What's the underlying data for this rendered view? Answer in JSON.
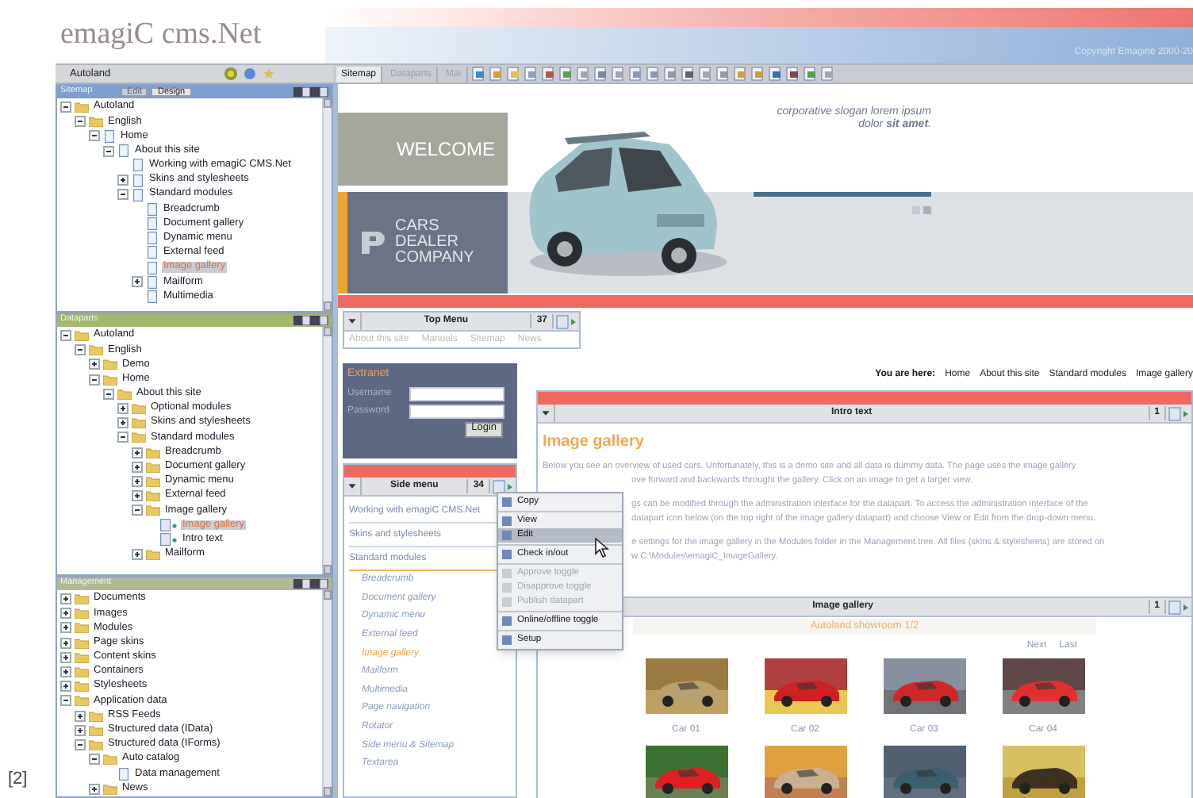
{
  "caption": "[2]",
  "logo": {
    "text": "emagiC cms.Net"
  },
  "header": {
    "copyright": "Copyright Emagine 2000-20"
  },
  "site_selector": {
    "value": "Autoland"
  },
  "view_tabs": [
    {
      "label": "Sitemap",
      "selected": true
    },
    {
      "label": "Dataparts",
      "selected": false
    },
    {
      "label": "Mai",
      "selected": false
    }
  ],
  "panels": [
    {
      "kind": "sitemap",
      "title": "Sitemap",
      "buttons": [
        {
          "label": "Edit",
          "disabled": true
        },
        {
          "label": "Design",
          "disabled": false
        }
      ],
      "tree": [
        {
          "label": "Autoland",
          "kind": "folder",
          "selected": false,
          "expanded": true,
          "children": [
            {
              "label": "English",
              "kind": "folder",
              "selected": false,
              "expanded": true,
              "children": [
                {
                  "label": "Home",
                  "kind": "page",
                  "selected": false,
                  "expanded": true,
                  "children": [
                    {
                      "label": "About this site",
                      "kind": "page",
                      "selected": false,
                      "expanded": true,
                      "children": [
                        {
                          "label": "Working with emagiC CMS.Net",
                          "kind": "page",
                          "selected": false
                        },
                        {
                          "label": "Skins and stylesheets",
                          "kind": "page",
                          "selected": false,
                          "expanded": false
                        },
                        {
                          "label": "Standard modules",
                          "kind": "page",
                          "selected": false,
                          "expanded": true,
                          "children": [
                            {
                              "label": "Breadcrumb",
                              "kind": "page",
                              "selected": false
                            },
                            {
                              "label": "Document gallery",
                              "kind": "page",
                              "selected": false
                            },
                            {
                              "label": "Dynamic menu",
                              "kind": "page",
                              "selected": false
                            },
                            {
                              "label": "External feed",
                              "kind": "page",
                              "selected": false
                            },
                            {
                              "label": "Image gallery",
                              "kind": "page",
                              "selected": true
                            },
                            {
                              "label": "Mailform",
                              "kind": "page",
                              "selected": false,
                              "expanded": false
                            },
                            {
                              "label": "Multimedia",
                              "kind": "page",
                              "selected": false
                            }
                          ]
                        }
                      ]
                    }
                  ]
                }
              ]
            }
          ]
        }
      ]
    },
    {
      "kind": "dataparts",
      "title": "Dataparts",
      "tree": [
        {
          "label": "Autoland",
          "kind": "folder",
          "selected": false,
          "expanded": true,
          "children": [
            {
              "label": "English",
              "kind": "folder",
              "selected": false,
              "expanded": true,
              "children": [
                {
                  "label": "Demo",
                  "kind": "folder",
                  "selected": false,
                  "expanded": false
                },
                {
                  "label": "Home",
                  "kind": "folder",
                  "selected": false,
                  "expanded": true,
                  "children": [
                    {
                      "label": "About this site",
                      "kind": "folder",
                      "selected": false,
                      "expanded": true,
                      "children": [
                        {
                          "label": "Optional modules",
                          "kind": "folder",
                          "selected": false,
                          "expanded": false
                        },
                        {
                          "label": "Skins and stylesheets",
                          "kind": "folder",
                          "selected": false,
                          "expanded": false
                        },
                        {
                          "label": "Standard modules",
                          "kind": "folder",
                          "selected": false,
                          "expanded": true,
                          "children": [
                            {
                              "label": "Breadcrumb",
                              "kind": "folder",
                              "selected": false,
                              "expanded": false
                            },
                            {
                              "label": "Document gallery",
                              "kind": "folder",
                              "selected": false,
                              "expanded": false
                            },
                            {
                              "label": "Dynamic menu",
                              "kind": "folder",
                              "selected": false,
                              "expanded": false
                            },
                            {
                              "label": "External feed",
                              "kind": "folder",
                              "selected": false,
                              "expanded": false
                            },
                            {
                              "label": "Image gallery",
                              "kind": "folder",
                              "selected": false,
                              "expanded": true,
                              "children": [
                                {
                                  "label": "Image gallery",
                                  "kind": "datapart",
                                  "selected": true
                                },
                                {
                                  "label": "Intro text",
                                  "kind": "datapart",
                                  "selected": false
                                }
                              ]
                            },
                            {
                              "label": "Mailform",
                              "kind": "folder",
                              "selected": false,
                              "expanded": false
                            }
                          ]
                        }
                      ]
                    }
                  ]
                }
              ]
            }
          ]
        }
      ]
    },
    {
      "kind": "management",
      "title": "Management",
      "tree": [
        {
          "label": "Documents",
          "kind": "folder",
          "selected": false,
          "expanded": false
        },
        {
          "label": "Images",
          "kind": "folder",
          "selected": false,
          "expanded": false
        },
        {
          "label": "Modules",
          "kind": "folder",
          "selected": false,
          "expanded": false
        },
        {
          "label": "Page skins",
          "kind": "folder",
          "selected": false,
          "expanded": false
        },
        {
          "label": "Content skins",
          "kind": "folder",
          "selected": false,
          "expanded": false
        },
        {
          "label": "Containers",
          "kind": "folder",
          "selected": false,
          "expanded": false
        },
        {
          "label": "Stylesheets",
          "kind": "folder",
          "selected": false,
          "expanded": false
        },
        {
          "label": "Application data",
          "kind": "folder",
          "selected": false,
          "expanded": true,
          "children": [
            {
              "label": "RSS Feeds",
              "kind": "folder",
              "selected": false,
              "expanded": false
            },
            {
              "label": "Structured data (IData)",
              "kind": "folder",
              "selected": false,
              "expanded": false
            },
            {
              "label": "Structured data (IForms)",
              "kind": "folder",
              "selected": false,
              "expanded": true,
              "children": [
                {
                  "label": "Auto catalog",
                  "kind": "folder",
                  "selected": false,
                  "expanded": true,
                  "children": [
                    {
                      "label": "Data management",
                      "kind": "page",
                      "selected": false
                    }
                  ]
                },
                {
                  "label": "News",
                  "kind": "folder",
                  "selected": false,
                  "expanded": false
                }
              ]
            }
          ]
        }
      ]
    }
  ],
  "banner": {
    "welcome": "WELCOME",
    "company": [
      "CARS",
      "DEALER",
      "COMPANY"
    ],
    "slogan": [
      "corporative slogan lorem ipsum",
      "dolor **sit amet**."
    ]
  },
  "menu_bar": {
    "control": {
      "title": "Top Menu",
      "count": "37"
    },
    "links": [
      "About this site",
      "Manuals",
      "Sitemap",
      "News"
    ]
  },
  "extranet": {
    "title": "Extranet",
    "fields": [
      {
        "label": "Username"
      },
      {
        "label": "Password"
      }
    ],
    "button": "Login"
  },
  "breadcrumb": {
    "label": "You are here:",
    "items": [
      "Home",
      "About this site",
      "Standard modules",
      "Image gallery"
    ]
  },
  "side_menu": {
    "control": {
      "title": "Side menu",
      "count": "34"
    },
    "items": [
      {
        "label": "Working with emagiC CMS.Net",
        "selected": false
      },
      {
        "label": "Skins and stylesheets",
        "selected": false
      },
      {
        "label": "Standard modules",
        "selected": true,
        "children": [
          {
            "label": "Breadcrumb",
            "selected": false
          },
          {
            "label": "Document gallery",
            "selected": false
          },
          {
            "label": "Dynamic menu",
            "selected": false
          },
          {
            "label": "External feed",
            "selected": false
          },
          {
            "label": "Image gallery",
            "selected": true
          },
          {
            "label": "Mailform",
            "selected": false
          },
          {
            "label": "Multimedia",
            "selected": false
          },
          {
            "label": "Page navigation",
            "selected": false
          },
          {
            "label": "Rotator",
            "selected": false
          },
          {
            "label": "Side menu & Sitemap",
            "selected": false
          },
          {
            "label": "Textarea",
            "selected": false
          }
        ]
      }
    ]
  },
  "context_menu": {
    "items": [
      {
        "kind": "item",
        "label": "Copy",
        "disabled": false,
        "selected": false
      },
      {
        "kind": "separator"
      },
      {
        "kind": "item",
        "label": "View",
        "disabled": false,
        "selected": false
      },
      {
        "kind": "item",
        "label": "Edit",
        "disabled": false,
        "selected": true
      },
      {
        "kind": "separator"
      },
      {
        "kind": "item",
        "label": "Check in/out",
        "disabled": false,
        "selected": false
      },
      {
        "kind": "separator"
      },
      {
        "kind": "item",
        "label": "Approve toggle",
        "disabled": true,
        "selected": false
      },
      {
        "kind": "item",
        "label": "Disapprove toggle",
        "disabled": true,
        "selected": false
      },
      {
        "kind": "item",
        "label": "Publish datapart",
        "disabled": true,
        "selected": false
      },
      {
        "kind": "separator"
      },
      {
        "kind": "item",
        "label": "Online/offline toggle",
        "disabled": false,
        "selected": false
      },
      {
        "kind": "separator"
      },
      {
        "kind": "item",
        "label": "Setup",
        "disabled": false,
        "selected": false
      }
    ]
  },
  "intro": {
    "control": {
      "title": "Intro text",
      "count": "1"
    },
    "heading": "Image gallery",
    "paragraphs": [
      [
        {
          "text": "Below you see an overview of used cars. Unfortunately, this is a demo site and all data is dummy data. The page uses the image gallery",
          "covered": false
        },
        {
          "text": "ove forward and backwards throught the gallery. Click on an image to get a larger view.",
          "covered": true
        }
      ],
      [
        {
          "text": "gs can be modified through the administration interface for the datapart.  To access the administration interface of the",
          "covered": true
        },
        {
          "text": "datapart icon below (on the top right of the image gallery datapart) and choose View or Edit from the drop-down menu.",
          "covered": true
        }
      ],
      [
        {
          "text": "e settings for the image gallery in the Modules folder in the Management tree.  All files (skins & stylesheets) are stored on",
          "covered": true
        },
        {
          "text": "w C:\\Modules\\emagiC_ImageGallery.",
          "covered": true
        }
      ]
    ]
  },
  "gallery": {
    "control": {
      "title": "Image gallery",
      "count": "1"
    },
    "title": "Autoland showroom 1/2",
    "pager": [
      "Next",
      "Last"
    ],
    "thumbs": [
      {
        "kind": "picture",
        "caption": "Car 01"
      },
      {
        "kind": "picture",
        "caption": "Car 02"
      },
      {
        "kind": "picture",
        "caption": "Car 03"
      },
      {
        "kind": "picture",
        "caption": "Car 04"
      },
      {
        "kind": "picture"
      },
      {
        "kind": "picture"
      },
      {
        "kind": "picture"
      },
      {
        "kind": "picture"
      }
    ]
  }
}
